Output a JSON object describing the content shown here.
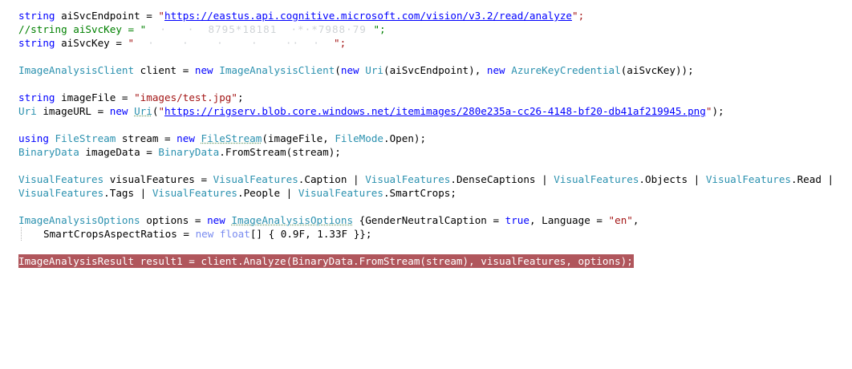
{
  "editor": {
    "l1": {
      "kw": "string",
      "name": " aiSvcEndpoint = ",
      "q1": "\"",
      "url": "https://eastus.api.cognitive.microsoft.com/vision/v3.2/read/analyze",
      "q2": "\";"
    },
    "l2": {
      "comment": "//string aiSvcKey = \"",
      "redacted": "  ·   ·  8795*18181  ·*·*7988·79 ",
      "end": "\";"
    },
    "l3": {
      "kw": "string",
      "name": " aiSvcKey = ",
      "q1": "\"",
      "redacted": "  ·    ·    ·    ·    ··  ·  ",
      "q2": "\";"
    },
    "l5": {
      "type1": "ImageAnalysisClient",
      "t1": " client = ",
      "kw1": "new",
      "sp1": " ",
      "type2": "ImageAnalysisClient",
      "t2": "(",
      "kw2": "new",
      "sp2": " ",
      "type3": "Uri",
      "t3": "(aiSvcEndpoint), ",
      "kw3": "new",
      "sp3": " ",
      "type4": "AzureKeyCredential",
      "t4": "(aiSvcKey));"
    },
    "l7": {
      "kw": "string",
      "name": " imageFile = ",
      "str": "\"images/test.jpg\"",
      "end": ";"
    },
    "l8": {
      "type1": "Uri",
      "t1": " imageURL = ",
      "kw": "new",
      "sp": " ",
      "type2": "Uri",
      "t2": "(",
      "q1": "\"",
      "url": "https://rigserv.blob.core.windows.net/itemimages/280e235a-cc26-4148-bf20-db41af219945.png",
      "q2": "\"",
      "end": ");"
    },
    "l10": {
      "kw1": "using",
      "sp1": " ",
      "type1": "FileStream",
      "t1": " stream = ",
      "kw2": "new",
      "sp2": " ",
      "type2": "FileStream",
      "t2": "(imageFile, ",
      "type3": "FileMode",
      "t3": ".Open);"
    },
    "l11": {
      "type1": "BinaryData",
      "t1": " imageData = ",
      "type2": "BinaryData",
      "t2": ".FromStream(stream);"
    },
    "l13": {
      "type1": "VisualFeatures",
      "t1": " visualFeatures = ",
      "type2": "VisualFeatures",
      "t2": ".Caption | ",
      "type3": "VisualFeatures",
      "t3": ".DenseCaptions | ",
      "type4": "VisualFeatures",
      "t4": ".Objects | ",
      "type5": "VisualFeatures",
      "t5": ".Read |"
    },
    "l14": {
      "type1": "VisualFeatures",
      "t1": ".Tags | ",
      "type2": "VisualFeatures",
      "t2": ".People | ",
      "type3": "VisualFeatures",
      "t3": ".SmartCrops;"
    },
    "l16": {
      "type1": "ImageAnalysisOptions",
      "t1": " options = ",
      "kw1": "new",
      "sp1": " ",
      "type2": "ImageAnalysisOptions",
      "t2": " {GenderNeutralCaption = ",
      "kw2": "true",
      "t3": ", Language = ",
      "str": "\"en\"",
      "t4": ","
    },
    "l17": {
      "t1": "SmartCropsAspectRatios = ",
      "kw1": "new",
      "sp1": " ",
      "kw2": "float",
      "t2": "[] { 0.9F, 1.33F }};"
    },
    "l19": {
      "code": "ImageAnalysisResult result1 = client.Analyze(BinaryData.FromStream(stream), visualFeatures, options);"
    }
  }
}
